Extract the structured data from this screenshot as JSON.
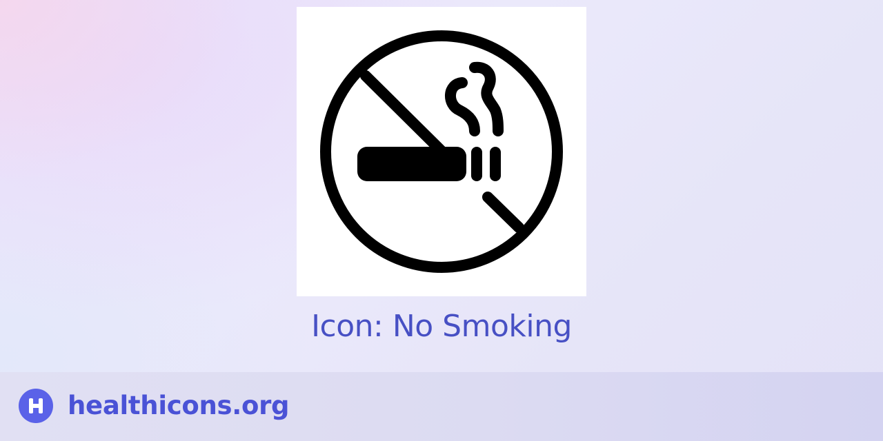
{
  "icon": {
    "name": "no-smoking-icon",
    "title": "Icon: No Smoking"
  },
  "footer": {
    "brand_name": "healthicons.org",
    "logo_letter": "H",
    "logo_icon": "healthicons-logo-icon"
  },
  "colors": {
    "title_text": "#4750c4",
    "brand_text": "#4a52d6",
    "badge": "#5a62e8",
    "icon_stroke": "#000000",
    "card_background": "#ffffff"
  }
}
